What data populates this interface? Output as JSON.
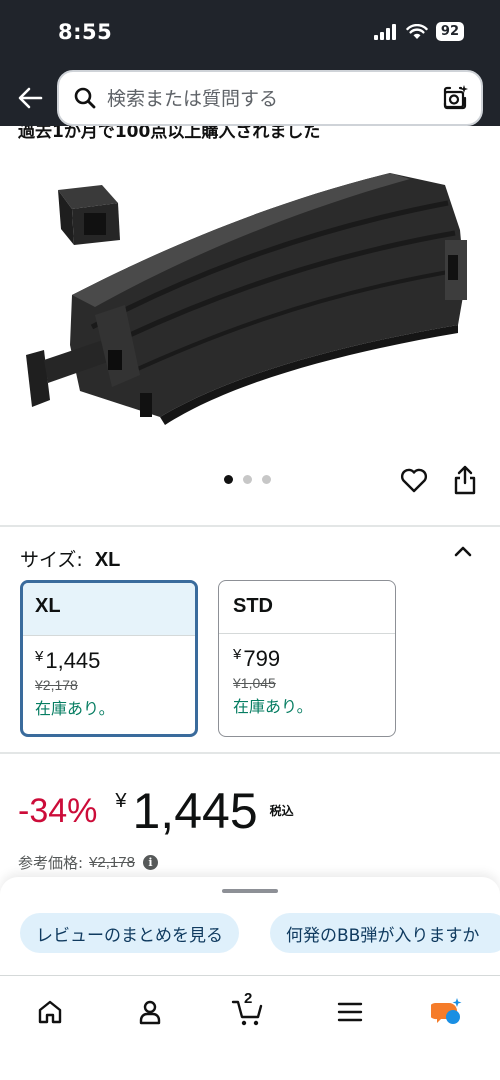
{
  "status_bar": {
    "time": "8:55",
    "battery": "92"
  },
  "header": {
    "search_placeholder": "検索または質問する"
  },
  "banner": {
    "text": "過去1か月で100点以上購入されました"
  },
  "product": {
    "image_icon": "magazine-loader-photo",
    "carousel_total": 3,
    "carousel_active": 1
  },
  "size_selector": {
    "label": "サイズ:",
    "selected": "XL",
    "options": [
      {
        "name": "XL",
        "yen": "¥",
        "price": "1,445",
        "list_price": "¥2,178",
        "stock": "在庫あり。"
      },
      {
        "name": "STD",
        "yen": "¥",
        "price": "799",
        "list_price": "¥1,045",
        "stock": "在庫あり。"
      }
    ]
  },
  "price": {
    "discount": "-34%",
    "yen": "¥",
    "amount": "1,445",
    "tax_label": "税込",
    "ref_label": "参考価格:",
    "ref_value": "¥2,178",
    "info_icon": "i"
  },
  "sheet": {
    "chips": [
      "レビューのまとめを見る",
      "何発のBB弾が入りますか"
    ]
  },
  "tabbar": {
    "cart_count": "2"
  },
  "colors": {
    "header_bg": "#20242b",
    "discount_red": "#cc0c39",
    "stock_green": "#067d62",
    "selected_border": "#3a6b9c",
    "chip_bg": "#dff0fb"
  }
}
